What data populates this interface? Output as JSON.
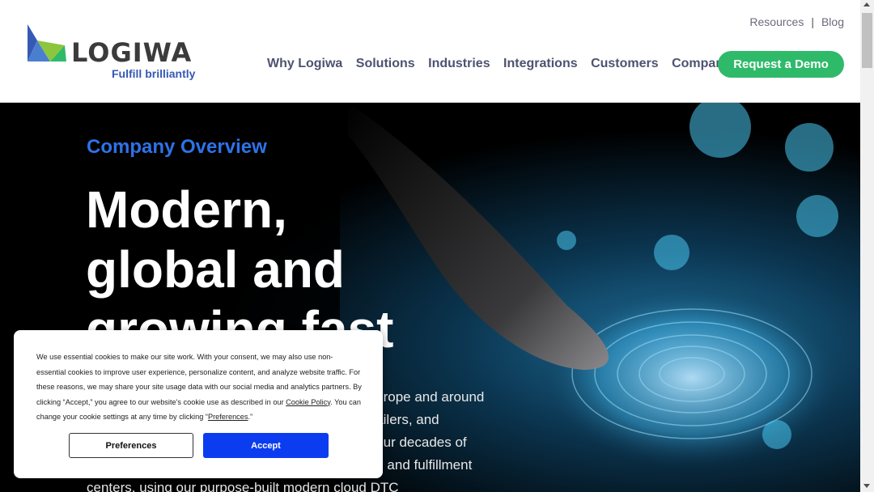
{
  "brand": {
    "name": "LOGIWA",
    "tagline": "Fulfill brilliantly",
    "colors": {
      "blue": "#3559b5",
      "green": "#2fba6a",
      "accent": "#2e72e8"
    }
  },
  "util_nav": {
    "resources": "Resources",
    "separator": "|",
    "blog": "Blog"
  },
  "main_nav": {
    "items": [
      "Why Logiwa",
      "Solutions",
      "Industries",
      "Integrations",
      "Customers",
      "Company"
    ],
    "cta": "Request a Demo"
  },
  "hero": {
    "eyebrow": "Company Overview",
    "headline_lines": [
      "Modern,",
      "global and",
      "growing fast"
    ],
    "body": "Logiwa has customers across North America, Europe and around the world. 3PLs, brands, wholesalers, online retailers, and eCommerce businesses of every size leverage our decades of experience to manage thousands of warehouses and fulfillment centers, using our purpose-built modern cloud DTC",
    "image": "finger-touching-fingerprint-circuit-image"
  },
  "cookie_banner": {
    "text_before_policy": "We use essential cookies to make our site work. With your consent, we may also use non-essential cookies to improve user experience, personalize content, and analyze website traffic. For these reasons, we may share your site usage data with our social media and analytics partners. By clicking “Accept,” you agree to our website's cookie use as described in our ",
    "policy_link": "Cookie Policy",
    "text_after_policy": ". You can change your cookie settings at any time by clicking “",
    "preferences_link": "Preferences",
    "text_end": ".”",
    "preferences_button": "Preferences",
    "accept_button": "Accept",
    "accept_color": "#0c3cf0"
  }
}
